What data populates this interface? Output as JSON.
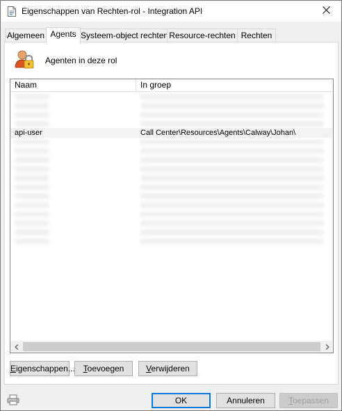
{
  "window": {
    "title": "Eigenschappen van Rechten-rol - Integration API",
    "close_glyph": "✕"
  },
  "tabs": [
    {
      "label": "Algemeen",
      "active": false
    },
    {
      "label": "Agents",
      "active": true
    },
    {
      "label": "Systeem-object rechten",
      "active": false
    },
    {
      "label": "Resource-rechten",
      "active": false
    },
    {
      "label": "Rechten",
      "active": false
    }
  ],
  "panel": {
    "header_label": "Agenten in deze rol",
    "header_icon": "user-lock-icon"
  },
  "listview": {
    "columns": [
      "Naam",
      "In groep"
    ],
    "rows": [
      {
        "naam": "",
        "groep": "",
        "blurred": true
      },
      {
        "naam": "",
        "groep": "",
        "blurred": true
      },
      {
        "naam": "",
        "groep": "",
        "blurred": true
      },
      {
        "naam": "",
        "groep": "",
        "blurred": true
      },
      {
        "naam": "api-user",
        "groep": "Call Center\\Resources\\Agents\\Calway\\Johan\\",
        "blurred": false,
        "selected": true
      },
      {
        "naam": "",
        "groep": "",
        "blurred": true
      },
      {
        "naam": "",
        "groep": "",
        "blurred": true
      },
      {
        "naam": "",
        "groep": "",
        "blurred": true
      },
      {
        "naam": "",
        "groep": "",
        "blurred": true
      },
      {
        "naam": "",
        "groep": "",
        "blurred": true
      },
      {
        "naam": "",
        "groep": "",
        "blurred": true
      },
      {
        "naam": "",
        "groep": "",
        "blurred": true
      },
      {
        "naam": "",
        "groep": "",
        "blurred": true
      },
      {
        "naam": "",
        "groep": "",
        "blurred": true
      },
      {
        "naam": "",
        "groep": "",
        "blurred": true
      },
      {
        "naam": "",
        "groep": "",
        "blurred": true
      },
      {
        "naam": "",
        "groep": "",
        "blurred": true
      }
    ]
  },
  "panel_buttons": {
    "properties": {
      "pre": "",
      "key": "E",
      "post": "igenschappen..."
    },
    "add": {
      "pre": "",
      "key": "T",
      "post": "oevoegen"
    },
    "remove": {
      "pre": "",
      "key": "V",
      "post": "erwijderen"
    }
  },
  "footer": {
    "ok": "OK",
    "cancel": "Annuleren",
    "apply": {
      "pre": "",
      "key": "T",
      "post": "oepassen",
      "disabled": true
    },
    "print_icon": "printer-icon"
  },
  "colors": {
    "accent": "#0078d7",
    "selected_row": "#f3f3f3"
  }
}
